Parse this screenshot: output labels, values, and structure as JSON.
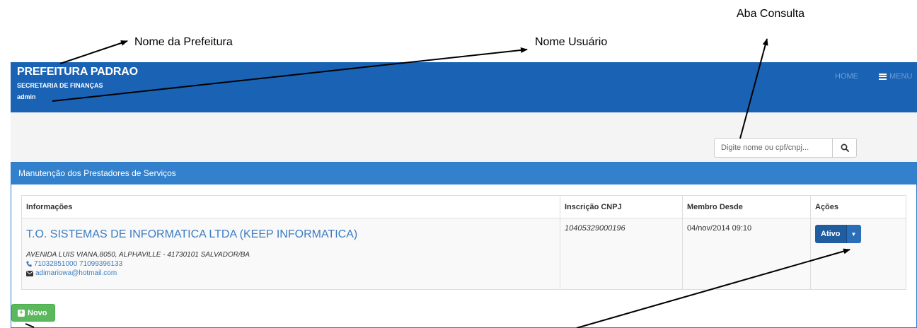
{
  "annotations": {
    "prefeitura": "Nome da Prefeitura",
    "usuario": "Nome Usuário",
    "consulta": "Aba Consulta"
  },
  "header": {
    "title": "PREFEITURA PADRAO",
    "subtitle": "SECRETARIA DE FINANÇAS",
    "user": "admin",
    "nav_home": "HOME",
    "nav_menu": "MENU"
  },
  "search": {
    "placeholder": "Digite nome ou cpf/cnpj..."
  },
  "panel": {
    "title": "Manutenção dos Prestadores de Serviços",
    "columns": [
      "Informações",
      "Inscrição CNPJ",
      "Membro Desde",
      "Ações"
    ],
    "rows": [
      {
        "name": "T.O. SISTEMAS DE INFORMATICA LTDA (KEEP INFORMATICA)",
        "address": "AVENIDA LUIS VIANA,8050, ALPHAVILLE - 41730101 SALVADOR/BA",
        "phones": "71032851000 71099396133",
        "email": "adimariowa@hotmail.com",
        "cnpj": "10405329000196",
        "member_since": "04/nov/2014 09:10",
        "status": "Ativo"
      }
    ]
  },
  "buttons": {
    "novo": "Novo"
  },
  "colors": {
    "header": "#1a62b4",
    "panel_head": "#3380cc",
    "primary": "#1f5da0",
    "success": "#5cb85c"
  },
  "icons": [
    "search-icon",
    "menu-icon",
    "phone-icon",
    "envelope-icon",
    "plus-square-icon",
    "caret-down-icon"
  ]
}
